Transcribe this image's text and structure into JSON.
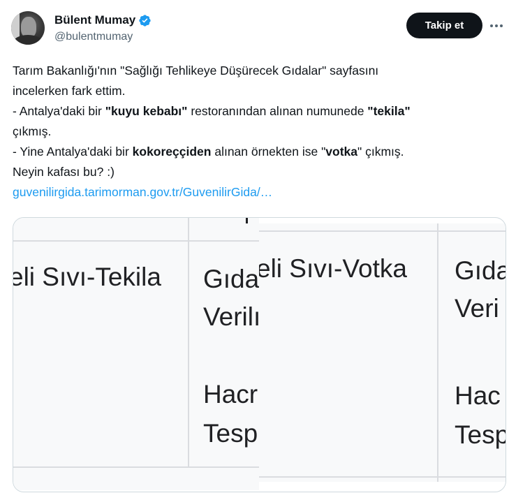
{
  "author": {
    "display_name": "Bülent Mumay",
    "handle": "@bulentmumay",
    "verified_color": "#1d9bf0"
  },
  "actions": {
    "follow_label": "Takip et",
    "more_icon": "more-dots-icon"
  },
  "tweet": {
    "line1": "Tarım Bakanlığı'nın \"Sağlığı Tehlikeye Düşürecek Gıdalar\" sayfasını",
    "line2": "incelerken fark ettim.",
    "line3_a": "- Antalya'daki bir ",
    "line3_b": "\"kuyu kebabı\"",
    "line3_c": " restoranından alınan numunede ",
    "line3_d": "\"tekila\"",
    "line4": "çıkmış.",
    "line5_a": "- Yine Antalya'daki bir ",
    "line5_b": "kokoreççiden",
    "line5_c": " alınan örnekten ise \"",
    "line5_d": "votka",
    "line5_e": "\" çıkmış.",
    "line6": "Neyin kafası bu? :)",
    "link": "guvenilirgida.tarimorman.gov.tr/GuvenilirGida/…"
  },
  "media": {
    "left": {
      "cell1": "eli Sıvı-Tekila",
      "cell2_line1": "Gıda",
      "cell2_line2": "Verilı",
      "cell2_line3": "Hacr",
      "cell2_line4": "Tesp"
    },
    "right": {
      "cell1": "eli Sıvı-Votka",
      "cell2_line1": "Gıda",
      "cell2_line2": "Veri",
      "cell2_line3": "Hac",
      "cell2_line4": "Tesp"
    }
  }
}
